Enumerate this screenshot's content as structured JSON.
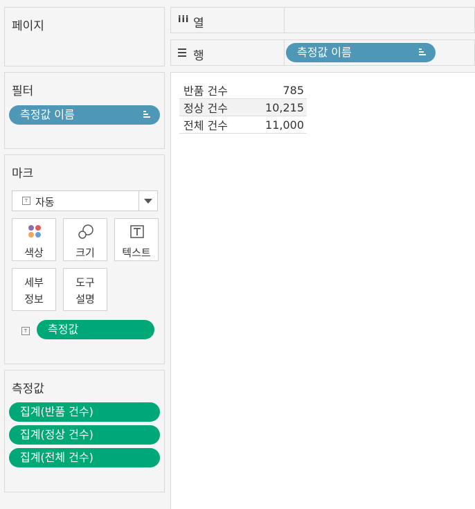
{
  "pages": {
    "title": "페이지"
  },
  "filters": {
    "title": "필터",
    "pills": [
      {
        "label": "측정값 이름"
      }
    ]
  },
  "marks": {
    "title": "마크",
    "dropdown_value": "자동",
    "buttons": {
      "color": "색상",
      "size": "크기",
      "text": "텍스트",
      "detail": "세부\n정보",
      "tooltip": "도구\n설명"
    },
    "text_pill": "측정값"
  },
  "measures": {
    "title": "측정값",
    "pills": [
      {
        "label": "집계(반품 건수)"
      },
      {
        "label": "집계(정상 건수)"
      },
      {
        "label": "집계(전체 건수)"
      }
    ]
  },
  "shelves": {
    "columns_label": "열",
    "rows_label": "행",
    "rows_pill": "측정값 이름"
  },
  "table": {
    "rows": [
      {
        "name": "반품 건수",
        "value": "785"
      },
      {
        "name": "정상 건수",
        "value": "10,215"
      },
      {
        "name": "전체 건수",
        "value": "11,000"
      }
    ]
  },
  "colors": {
    "blue_pill": "#4e97b7",
    "green_pill": "#00a878"
  }
}
